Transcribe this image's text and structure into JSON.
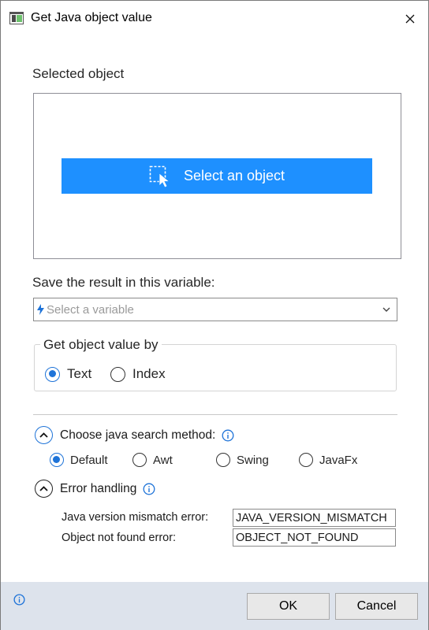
{
  "window": {
    "title": "Get Java object value",
    "close_icon": "close-icon"
  },
  "selected_object": {
    "label": "Selected object",
    "button_label": "Select an object",
    "button_icon": "select-object-icon",
    "accent_color": "#1e90ff"
  },
  "save_result": {
    "label": "Save the result in this variable:",
    "placeholder": "Select a variable",
    "value": ""
  },
  "get_by": {
    "legend": "Get object value by",
    "options": [
      "Text",
      "Index"
    ],
    "selected": "Text"
  },
  "java_search": {
    "label": "Choose java search method:",
    "options": [
      "Default",
      "Awt",
      "Swing",
      "JavaFx"
    ],
    "selected": "Default"
  },
  "error_handling": {
    "label": "Error handling",
    "version_mismatch_label": "Java version mismatch error:",
    "version_mismatch_value": "JAVA_VERSION_MISMATCH",
    "not_found_label": "Object not found error:",
    "not_found_value": "OBJECT_NOT_FOUND"
  },
  "footer": {
    "ok_label": "OK",
    "cancel_label": "Cancel",
    "background_color": "#dde3ec"
  }
}
